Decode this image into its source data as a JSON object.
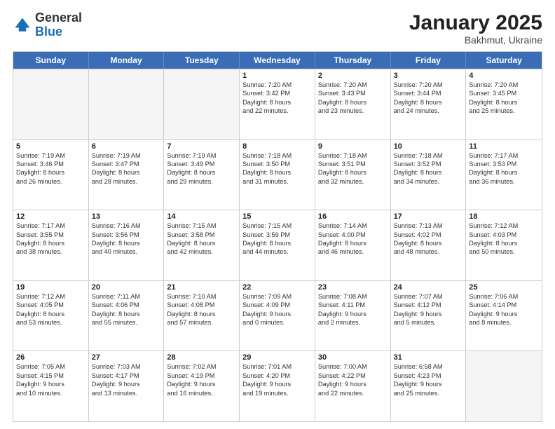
{
  "header": {
    "logo_general": "General",
    "logo_blue": "Blue",
    "month_title": "January 2025",
    "subtitle": "Bakhmut, Ukraine"
  },
  "days_of_week": [
    "Sunday",
    "Monday",
    "Tuesday",
    "Wednesday",
    "Thursday",
    "Friday",
    "Saturday"
  ],
  "rows": [
    [
      {
        "day": "",
        "info": "",
        "empty": true
      },
      {
        "day": "",
        "info": "",
        "empty": true
      },
      {
        "day": "",
        "info": "",
        "empty": true
      },
      {
        "day": "1",
        "info": "Sunrise: 7:20 AM\nSunset: 3:42 PM\nDaylight: 8 hours\nand 22 minutes.",
        "empty": false
      },
      {
        "day": "2",
        "info": "Sunrise: 7:20 AM\nSunset: 3:43 PM\nDaylight: 8 hours\nand 23 minutes.",
        "empty": false
      },
      {
        "day": "3",
        "info": "Sunrise: 7:20 AM\nSunset: 3:44 PM\nDaylight: 8 hours\nand 24 minutes.",
        "empty": false
      },
      {
        "day": "4",
        "info": "Sunrise: 7:20 AM\nSunset: 3:45 PM\nDaylight: 8 hours\nand 25 minutes.",
        "empty": false
      }
    ],
    [
      {
        "day": "5",
        "info": "Sunrise: 7:19 AM\nSunset: 3:46 PM\nDaylight: 8 hours\nand 26 minutes.",
        "empty": false
      },
      {
        "day": "6",
        "info": "Sunrise: 7:19 AM\nSunset: 3:47 PM\nDaylight: 8 hours\nand 28 minutes.",
        "empty": false
      },
      {
        "day": "7",
        "info": "Sunrise: 7:19 AM\nSunset: 3:49 PM\nDaylight: 8 hours\nand 29 minutes.",
        "empty": false
      },
      {
        "day": "8",
        "info": "Sunrise: 7:18 AM\nSunset: 3:50 PM\nDaylight: 8 hours\nand 31 minutes.",
        "empty": false
      },
      {
        "day": "9",
        "info": "Sunrise: 7:18 AM\nSunset: 3:51 PM\nDaylight: 8 hours\nand 32 minutes.",
        "empty": false
      },
      {
        "day": "10",
        "info": "Sunrise: 7:18 AM\nSunset: 3:52 PM\nDaylight: 8 hours\nand 34 minutes.",
        "empty": false
      },
      {
        "day": "11",
        "info": "Sunrise: 7:17 AM\nSunset: 3:53 PM\nDaylight: 8 hours\nand 36 minutes.",
        "empty": false
      }
    ],
    [
      {
        "day": "12",
        "info": "Sunrise: 7:17 AM\nSunset: 3:55 PM\nDaylight: 8 hours\nand 38 minutes.",
        "empty": false
      },
      {
        "day": "13",
        "info": "Sunrise: 7:16 AM\nSunset: 3:56 PM\nDaylight: 8 hours\nand 40 minutes.",
        "empty": false
      },
      {
        "day": "14",
        "info": "Sunrise: 7:15 AM\nSunset: 3:58 PM\nDaylight: 8 hours\nand 42 minutes.",
        "empty": false
      },
      {
        "day": "15",
        "info": "Sunrise: 7:15 AM\nSunset: 3:59 PM\nDaylight: 8 hours\nand 44 minutes.",
        "empty": false
      },
      {
        "day": "16",
        "info": "Sunrise: 7:14 AM\nSunset: 4:00 PM\nDaylight: 8 hours\nand 46 minutes.",
        "empty": false
      },
      {
        "day": "17",
        "info": "Sunrise: 7:13 AM\nSunset: 4:02 PM\nDaylight: 8 hours\nand 48 minutes.",
        "empty": false
      },
      {
        "day": "18",
        "info": "Sunrise: 7:12 AM\nSunset: 4:03 PM\nDaylight: 8 hours\nand 50 minutes.",
        "empty": false
      }
    ],
    [
      {
        "day": "19",
        "info": "Sunrise: 7:12 AM\nSunset: 4:05 PM\nDaylight: 8 hours\nand 53 minutes.",
        "empty": false
      },
      {
        "day": "20",
        "info": "Sunrise: 7:11 AM\nSunset: 4:06 PM\nDaylight: 8 hours\nand 55 minutes.",
        "empty": false
      },
      {
        "day": "21",
        "info": "Sunrise: 7:10 AM\nSunset: 4:08 PM\nDaylight: 8 hours\nand 57 minutes.",
        "empty": false
      },
      {
        "day": "22",
        "info": "Sunrise: 7:09 AM\nSunset: 4:09 PM\nDaylight: 9 hours\nand 0 minutes.",
        "empty": false
      },
      {
        "day": "23",
        "info": "Sunrise: 7:08 AM\nSunset: 4:11 PM\nDaylight: 9 hours\nand 2 minutes.",
        "empty": false
      },
      {
        "day": "24",
        "info": "Sunrise: 7:07 AM\nSunset: 4:12 PM\nDaylight: 9 hours\nand 5 minutes.",
        "empty": false
      },
      {
        "day": "25",
        "info": "Sunrise: 7:06 AM\nSunset: 4:14 PM\nDaylight: 9 hours\nand 8 minutes.",
        "empty": false
      }
    ],
    [
      {
        "day": "26",
        "info": "Sunrise: 7:05 AM\nSunset: 4:15 PM\nDaylight: 9 hours\nand 10 minutes.",
        "empty": false
      },
      {
        "day": "27",
        "info": "Sunrise: 7:03 AM\nSunset: 4:17 PM\nDaylight: 9 hours\nand 13 minutes.",
        "empty": false
      },
      {
        "day": "28",
        "info": "Sunrise: 7:02 AM\nSunset: 4:19 PM\nDaylight: 9 hours\nand 16 minutes.",
        "empty": false
      },
      {
        "day": "29",
        "info": "Sunrise: 7:01 AM\nSunset: 4:20 PM\nDaylight: 9 hours\nand 19 minutes.",
        "empty": false
      },
      {
        "day": "30",
        "info": "Sunrise: 7:00 AM\nSunset: 4:22 PM\nDaylight: 9 hours\nand 22 minutes.",
        "empty": false
      },
      {
        "day": "31",
        "info": "Sunrise: 6:58 AM\nSunset: 4:23 PM\nDaylight: 9 hours\nand 25 minutes.",
        "empty": false
      },
      {
        "day": "",
        "info": "",
        "empty": true
      }
    ]
  ]
}
